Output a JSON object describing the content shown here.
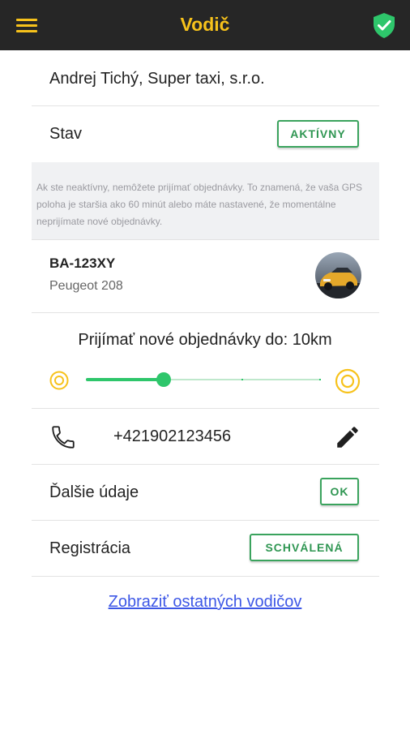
{
  "header": {
    "title": "Vodič",
    "menu_icon": "hamburger-menu-icon",
    "status_icon": "shield-check-icon",
    "accent_color": "#f7c21b",
    "status_color": "#2ec66b"
  },
  "driver": {
    "name": "Andrej Tichý, Super taxi, s.r.o."
  },
  "status": {
    "label": "Stav",
    "value_button": "AKTÍVNY"
  },
  "notice": {
    "text": "Ak ste neaktívny, nemôžete prijímať objednávky. To znamená, že vaša GPS poloha je staršia ako 60 minút alebo máte nastavené, že momentálne neprijímate nové objednávky."
  },
  "vehicle": {
    "plate": "BA-123XY",
    "model": "Peugeot 208"
  },
  "range": {
    "label": "Prijímať nové objednávky do: 10km",
    "slider_fraction": 0.33
  },
  "phone": {
    "number": "+421902123456",
    "phone_icon": "phone-icon",
    "edit_icon": "pencil-icon"
  },
  "details": {
    "label": "Ďalšie údaje",
    "button": "OK"
  },
  "registration": {
    "label": "Registrácia",
    "button": "SCHVÁLENÁ"
  },
  "footer_link": {
    "text": "Zobraziť ostatných vodičov"
  }
}
